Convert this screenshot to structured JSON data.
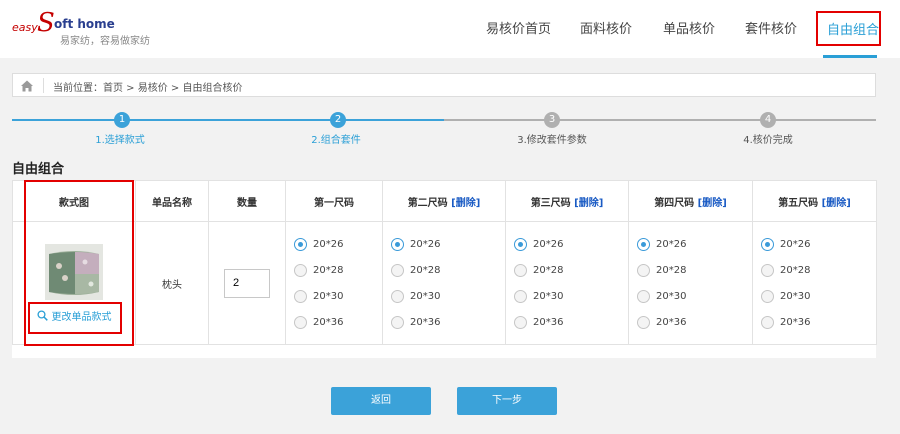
{
  "logo": {
    "easy": "easy",
    "s": "S",
    "soft": "oft home",
    "slogan": "易家纺，容易做家纺"
  },
  "nav": {
    "items": [
      "易核价首页",
      "面料核价",
      "单品核价",
      "套件核价"
    ],
    "active": "自由组合"
  },
  "breadcrumb": {
    "text": "当前位置：首页 > 易核价 > 自由组合核价"
  },
  "steps": [
    {
      "num": "1",
      "label": "1.选择款式"
    },
    {
      "num": "2",
      "label": "2.组合套件"
    },
    {
      "num": "3",
      "label": "3.修改套件参数"
    },
    {
      "num": "4",
      "label": "4.核价完成"
    }
  ],
  "section_title": "自由组合",
  "table": {
    "headers": {
      "image": "款式图",
      "name": "单品名称",
      "qty": "数量",
      "size1": "第一尺码",
      "size2": "第二尺码",
      "size3": "第三尺码",
      "size4": "第四尺码",
      "size5": "第五尺码",
      "delete": "[删除]"
    },
    "row": {
      "name": "枕头",
      "qty": "2",
      "change_link": "更改单品款式",
      "sizes": [
        "20*26",
        "20*28",
        "20*30",
        "20*36"
      ]
    }
  },
  "buttons": {
    "back": "返回",
    "next": "下一步"
  },
  "colors": {
    "accent": "#2a9fd6",
    "highlight_red": "#e30000",
    "button": "#3ba2d9",
    "inactive_step": "#b0b0b0"
  }
}
